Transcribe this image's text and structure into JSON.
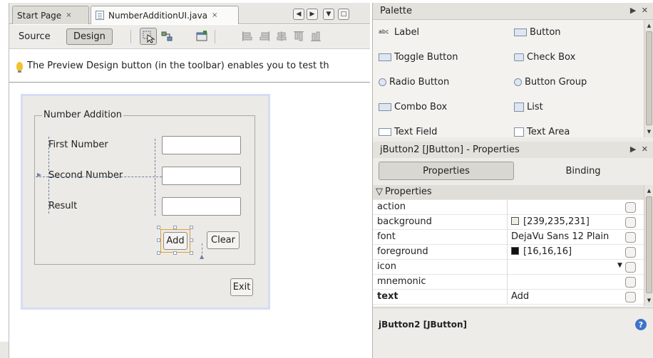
{
  "editor": {
    "tabs": [
      {
        "label": "Start Page",
        "close": "×"
      },
      {
        "label": "NumberAdditionUI.java",
        "close": "×"
      }
    ],
    "toolbar": {
      "source_label": "Source",
      "design_label": "Design"
    },
    "info_text": "The Preview Design button (in the toolbar) enables you to test th"
  },
  "form": {
    "legend": "Number Addition",
    "labels": {
      "first": "First Number",
      "second": "Second Number",
      "result": "Result"
    },
    "buttons": {
      "add": "Add",
      "clear": "Clear",
      "exit": "Exit"
    }
  },
  "palette": {
    "title": "Palette",
    "items": [
      "Label",
      "Button",
      "Toggle Button",
      "Check Box",
      "Radio Button",
      "Button Group",
      "Combo Box",
      "List",
      "Text Field",
      "Text Area"
    ]
  },
  "properties": {
    "title": "jButton2 [JButton] - Properties",
    "tabs": [
      "Properties",
      "Binding"
    ],
    "section": "Properties",
    "rows": [
      {
        "name": "action",
        "value": ""
      },
      {
        "name": "background",
        "value": "[239,235,231]"
      },
      {
        "name": "font",
        "value": "DejaVu Sans 12 Plain"
      },
      {
        "name": "foreground",
        "value": "[16,16,16]"
      },
      {
        "name": "icon",
        "value": ""
      },
      {
        "name": "mnemonic",
        "value": ""
      },
      {
        "name": "text",
        "value": "Add"
      }
    ],
    "status_text": "jButton2 [JButton]",
    "help": "?"
  },
  "colors": {
    "background_swatch": "#efebe7",
    "foreground_swatch": "#101010",
    "selection": "#e0a030"
  }
}
